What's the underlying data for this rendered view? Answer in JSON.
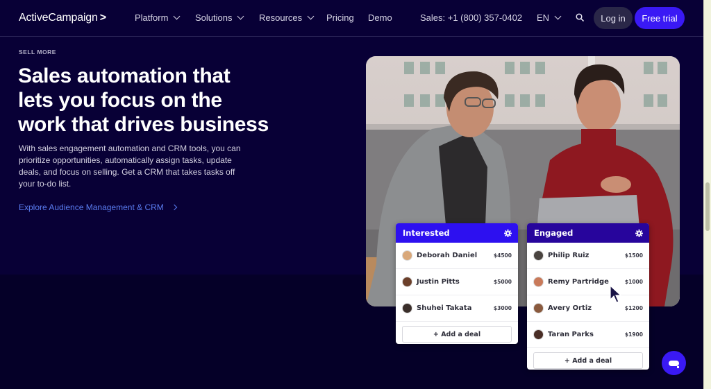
{
  "header": {
    "logo": "ActiveCampaign",
    "logo_mark": ">",
    "nav": [
      {
        "label": "Platform",
        "has_dropdown": true
      },
      {
        "label": "Solutions",
        "has_dropdown": true
      },
      {
        "label": "Resources",
        "has_dropdown": true
      },
      {
        "label": "Pricing",
        "has_dropdown": false
      },
      {
        "label": "Demo",
        "has_dropdown": false
      }
    ],
    "sales_phone": "Sales: +1 (800) 357-0402",
    "language": "EN",
    "search_icon": "search-icon",
    "login_label": "Log in",
    "trial_label": "Free trial"
  },
  "hero": {
    "eyebrow": "SELL MORE",
    "headline_lines": [
      "Sales automation that",
      "lets you focus on the",
      "work that drives business"
    ],
    "body": "With sales engagement automation and CRM tools, you can prioritize opportunities, automatically assign tasks, update deals, and focus on selling. Get a CRM that takes tasks off your to-do list.",
    "link_label": "Explore Audience Management & CRM"
  },
  "pipeline": {
    "stages": [
      {
        "title": "Interested",
        "header_color": "#2d10f0",
        "deals": [
          {
            "name": "Deborah Daniel",
            "amount": "$4500",
            "avatar_color": "#d9a87a"
          },
          {
            "name": "Justin Pitts",
            "amount": "$5000",
            "avatar_color": "#6b3f2a"
          },
          {
            "name": "Shuhei Takata",
            "amount": "$3000",
            "avatar_color": "#3a2e2a"
          }
        ],
        "add_label": "+ Add a deal"
      },
      {
        "title": "Engaged",
        "header_color": "#27059c",
        "deals": [
          {
            "name": "Philip Ruiz",
            "amount": "$1500",
            "avatar_color": "#4a4440"
          },
          {
            "name": "Remy Partridge",
            "amount": "$1000",
            "avatar_color": "#c97a5a"
          },
          {
            "name": "Avery Ortiz",
            "amount": "$1200",
            "avatar_color": "#8a5a3e"
          },
          {
            "name": "Taran Parks",
            "amount": "$1900",
            "avatar_color": "#4a2e26"
          }
        ],
        "add_label": "+ Add a deal"
      }
    ]
  },
  "colors": {
    "background": "#080036",
    "accent": "#3a19f5",
    "link": "#5a7cf0"
  }
}
